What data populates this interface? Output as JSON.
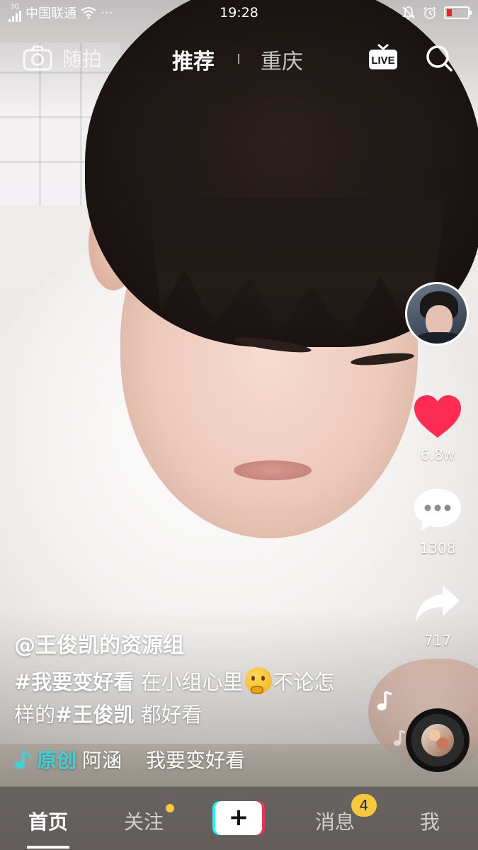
{
  "status_bar": {
    "network": "3G",
    "carrier": "中国联通",
    "more": "···",
    "time": "19:28"
  },
  "top_nav": {
    "shoot_label": "随拍",
    "tab_active": "推荐",
    "tab_city": "重庆",
    "live_label": "LIVE"
  },
  "video": {
    "likes": "6.8w",
    "comments": "1308",
    "shares": "717"
  },
  "caption": {
    "author": "@王俊凯的资源组",
    "hashtag1": "#我要变好看",
    "text1": " 在小组心里",
    "text2": "不论怎样的",
    "hashtag2": "#王俊凯",
    "text3": " 都好看"
  },
  "music": {
    "original_label": "原创",
    "artist": "阿涵",
    "title": "我要变好看"
  },
  "tab_bar": {
    "home": "首页",
    "follow": "关注",
    "create": "+",
    "messages": "消息",
    "messages_badge": "4",
    "me": "我"
  },
  "colors": {
    "like": "#fe2c55",
    "accent_cyan": "#25f4ee",
    "original_tag": "#42d0d6",
    "badge": "#f7c83b",
    "battery_low": "#e2242b"
  },
  "icons": {
    "shoot": "camera-icon",
    "live": "live-tv-icon",
    "search": "search-icon",
    "like": "heart-icon",
    "comment": "comment-bubble-icon",
    "share": "share-arrow-icon",
    "music": "music-note-icon"
  }
}
